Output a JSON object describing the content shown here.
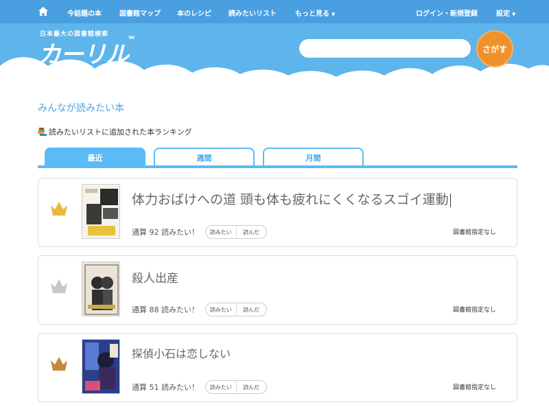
{
  "nav": {
    "items": [
      "今話題の本",
      "図書館マップ",
      "本のレシピ",
      "読みたいリスト",
      "もっと見る"
    ],
    "more_caret": "▼",
    "login": "ログイン・新規登録",
    "settings": "設定",
    "settings_caret": "▼"
  },
  "logo": {
    "subtitle": "日本最大の図書館検索",
    "name": "カーリル",
    "tm": "TM"
  },
  "search": {
    "placeholder": "",
    "value": "",
    "button": "さがす"
  },
  "page": {
    "title": "みんなが読みたい本",
    "section": "読みたいリストに追加された本ランキング"
  },
  "tabs": [
    "最近",
    "週間",
    "月間"
  ],
  "rankings": [
    {
      "title": "体力おばけへの道 頭も体も疲れにくくなるスゴイ運動",
      "stat": "通算 92 読みたい！",
      "want": "読みたい",
      "read": "読んだ",
      "library": "図書館指定なし",
      "crown_color": "#e8b93a"
    },
    {
      "title": "殺人出産",
      "stat": "通算 88 読みたい！",
      "want": "読みたい",
      "read": "読んだ",
      "library": "図書館指定なし",
      "crown_color": "#c8c8c8"
    },
    {
      "title": "探偵小石は恋しない",
      "stat": "通算 51 読みたい！",
      "want": "読みたい",
      "read": "読んだ",
      "library": "図書館指定なし",
      "crown_color": "#c58a3a"
    }
  ],
  "colors": {
    "nav": "#4a9fe0",
    "header": "#5db5ec",
    "accent": "#5bbbf4",
    "search_button": "#f0922b"
  }
}
